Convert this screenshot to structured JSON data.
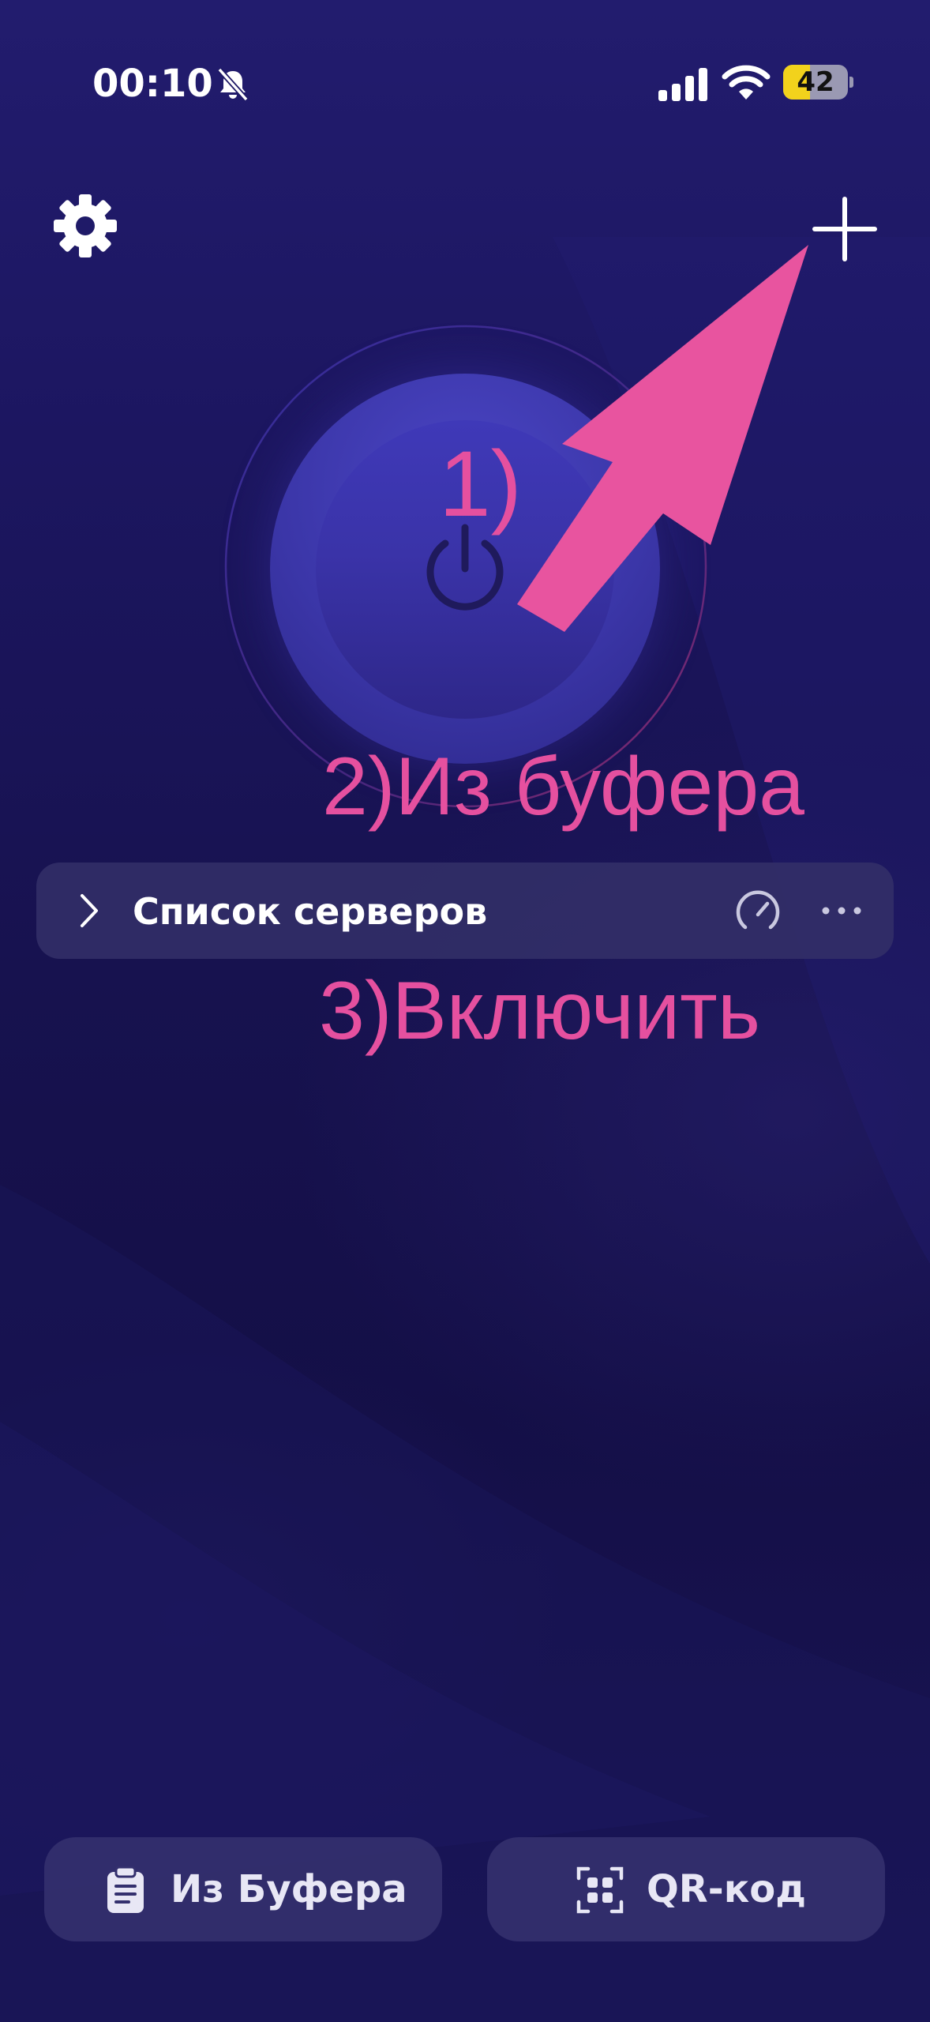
{
  "status_bar": {
    "time": "00:10",
    "battery_level": "42",
    "battery_fraction": 0.42,
    "icons": [
      "bell-slash-icon",
      "signal-icon",
      "wifi-icon",
      "battery-icon"
    ]
  },
  "header": {
    "settings_icon": "gear-icon",
    "add_icon": "plus-icon"
  },
  "power": {
    "icon": "power-icon"
  },
  "server_list": {
    "label": "Список серверов",
    "icons": [
      "chevron-right-icon",
      "speedometer-icon",
      "more-icon"
    ]
  },
  "bottom_actions": {
    "clipboard_label": "Из Буфера",
    "clipboard_icon": "clipboard-icon",
    "qr_label": "QR-код",
    "qr_icon": "qr-code-icon"
  },
  "annotations": {
    "step1": "1)",
    "step2": "2)Из буфера",
    "step3": "3)Включить",
    "color": "#e5509f"
  },
  "colors": {
    "background": "#1a1652",
    "power_button": "#3a33a8",
    "card": "#343069",
    "accent_annotation": "#e5509f",
    "battery_yellow": "#f2d21c"
  }
}
